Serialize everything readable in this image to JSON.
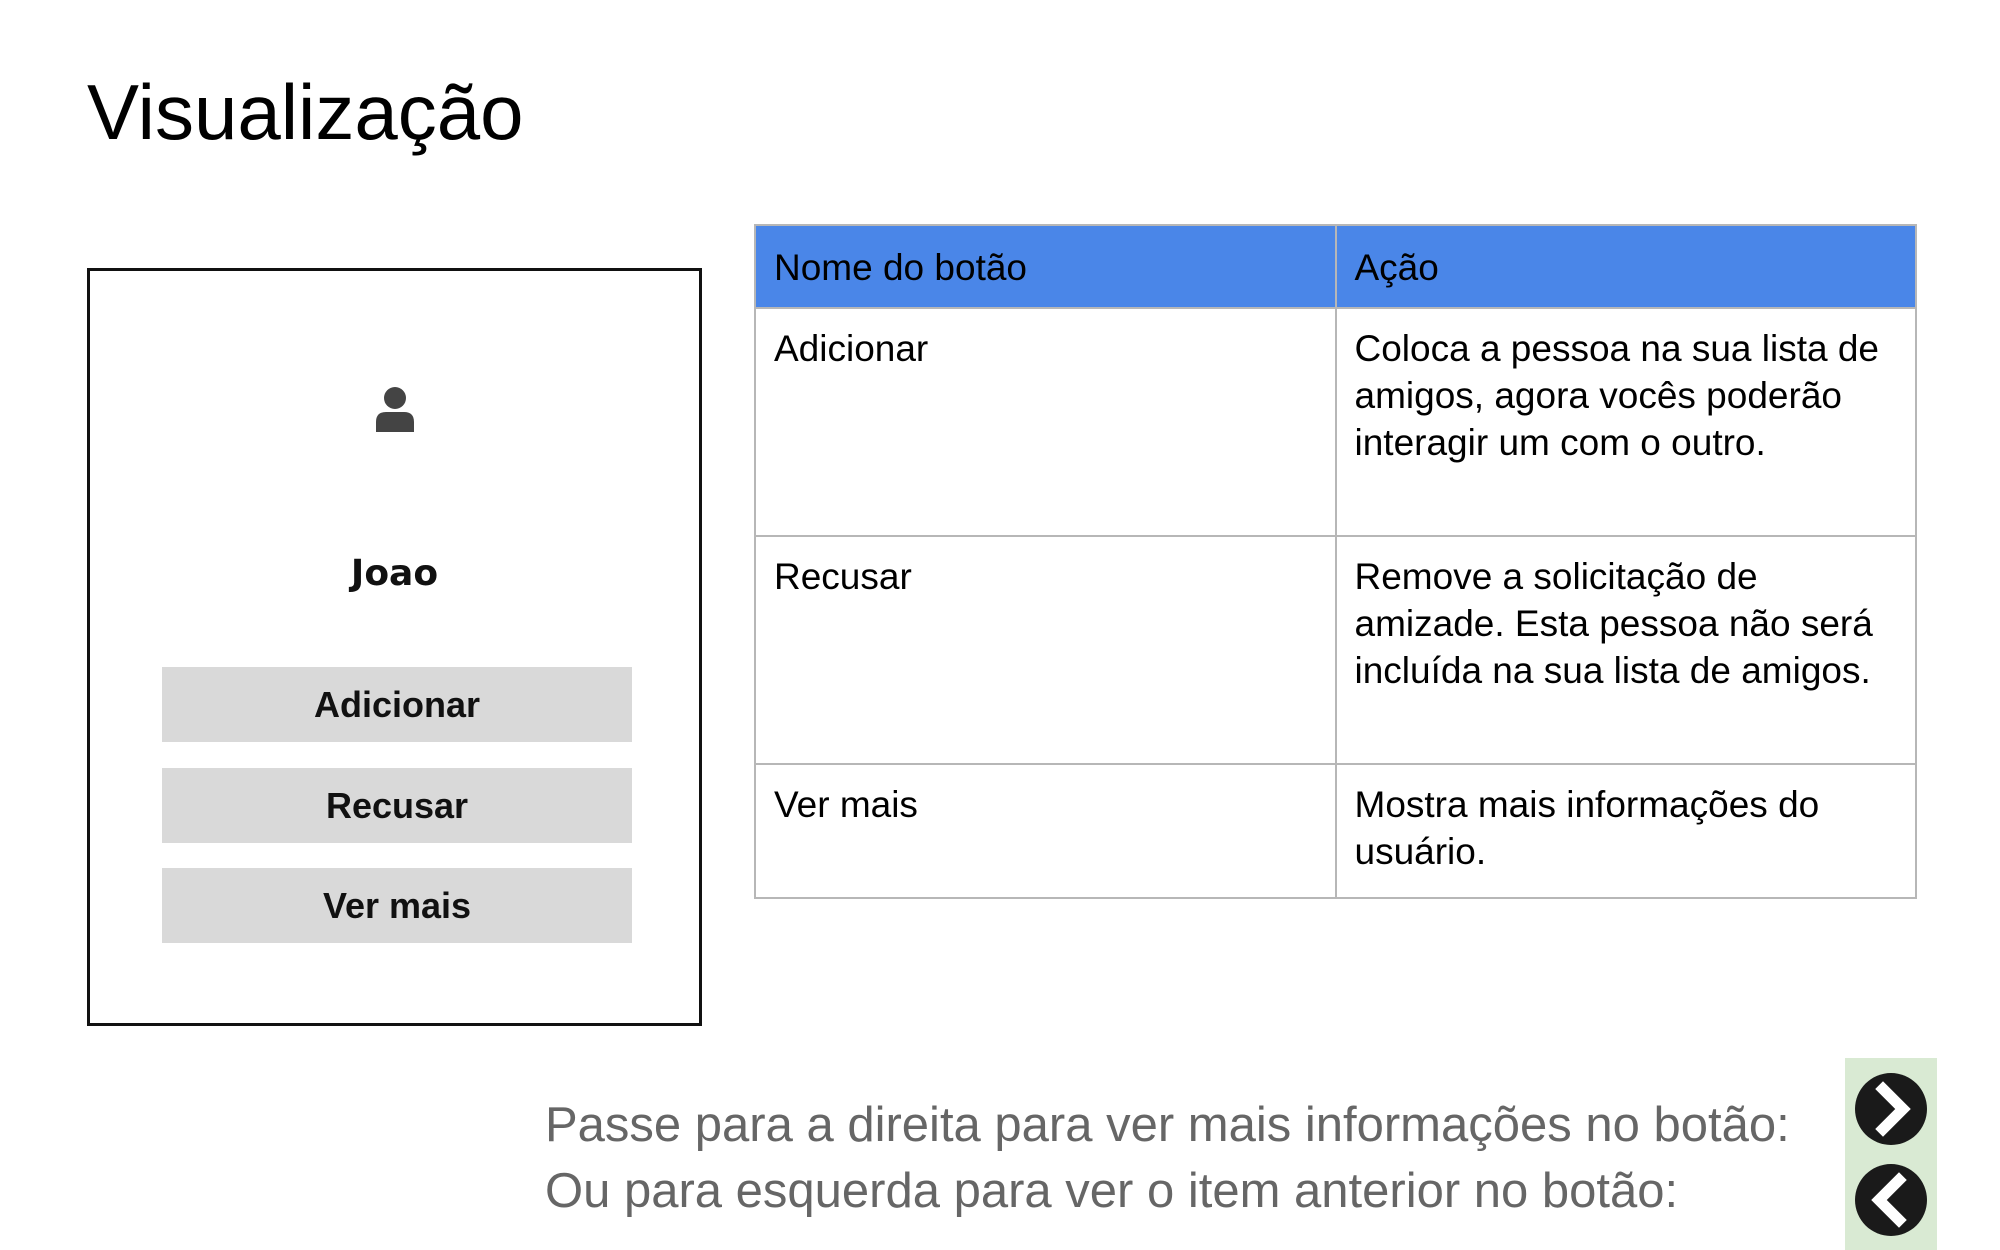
{
  "title": "Visualização",
  "card": {
    "avatar_icon": "user-icon",
    "name": "Joao",
    "buttons": {
      "add": "Adicionar",
      "refuse": "Recusar",
      "more": "Ver mais"
    }
  },
  "table": {
    "headers": [
      "Nome do botão",
      "Ação"
    ],
    "header_color": "#4a86e8",
    "rows": [
      {
        "name": "Adicionar",
        "action": "Coloca a pessoa na sua lista de amigos, agora vocês poderão interagir um com o outro."
      },
      {
        "name": "Recusar",
        "action": "Remove a solicitação de amizade. Esta pessoa não será incluída na sua lista de amigos."
      },
      {
        "name": "Ver mais",
        "action": "Mostra mais informações do usuário."
      }
    ]
  },
  "instructions": {
    "right": "Passe para a direita para ver mais informações no botão:",
    "left": "Ou para esquerda para ver o item anterior no botão:",
    "next_icon": "chevron-right-icon",
    "prev_icon": "chevron-left-icon"
  }
}
